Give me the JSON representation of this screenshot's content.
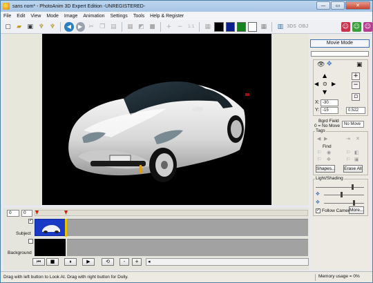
{
  "window": {
    "title": "sans nom* - PhotoAnim 3D Expert Edition -UNREGISTERED-",
    "controls": {
      "minimize": "—",
      "maximize": "▭",
      "close": "✕"
    }
  },
  "menu": [
    "File",
    "Edit",
    "View",
    "Mode",
    "Image",
    "Animation",
    "Settings",
    "Tools",
    "Help & Register"
  ],
  "toolbar": {
    "zoom_reset": "1:1",
    "format_3ds": "3DS",
    "format_obj": "OBJ",
    "colors": [
      "#000000",
      "#0b1f8a",
      "#16831d",
      "#ffffff"
    ]
  },
  "right_panel": {
    "mode_button": "Movie Mode",
    "x_label": "X:",
    "x_value": "-30",
    "y_label": "Y:",
    "y_value": "-15",
    "zoom_value": "0.522",
    "bgd_field_label": "Bgrd Field",
    "bgd_field_hint": "0 = No Move",
    "bgd_field_value": "No Move",
    "tags_label": "Tags",
    "find_label": "Find",
    "shapes_button": "Shapes...",
    "erase_all_button": "Erase All",
    "light_label": "Light/Shading",
    "follow_camera_label": "Follow Camera",
    "follow_camera_checked": true,
    "more_button": "More..."
  },
  "timeline": {
    "frame_start": "0",
    "frame_current": "0",
    "tracks": [
      {
        "name": "Subject",
        "checked": true
      },
      {
        "name": "Background",
        "checked": false
      }
    ],
    "playback": [
      "⏮",
      "■",
      "⏸",
      "▶",
      "⟲"
    ],
    "zoom_out": "-",
    "zoom_in": "+"
  },
  "status": {
    "hint": "Drag with left button to Look At. Drag with right button for Dolly.",
    "memory": "Memory usage = 0%"
  }
}
